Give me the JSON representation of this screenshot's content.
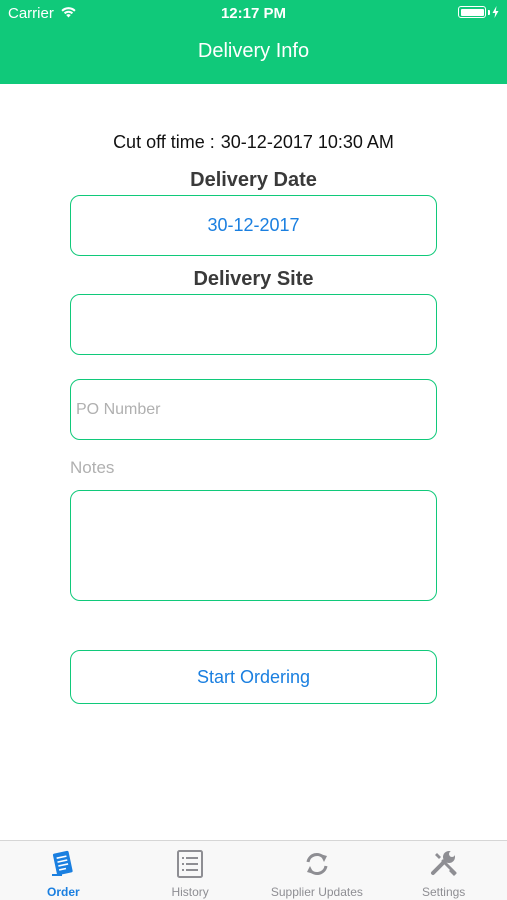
{
  "status_bar": {
    "carrier": "Carrier",
    "time": "12:17 PM"
  },
  "header": {
    "title": "Delivery Info"
  },
  "form": {
    "cutoff_label": "Cut off time :",
    "cutoff_value": "30-12-2017 10:30 AM",
    "delivery_date_label": "Delivery Date",
    "delivery_date_value": "30-12-2017",
    "delivery_site_label": "Delivery Site",
    "delivery_site_value": "",
    "po_number_placeholder": "PO Number",
    "notes_label": "Notes",
    "notes_value": "",
    "start_button_label": "Start Ordering"
  },
  "tabbar": {
    "tabs": [
      {
        "label": "Order",
        "icon": "order-icon",
        "active": true
      },
      {
        "label": "History",
        "icon": "history-icon",
        "active": false
      },
      {
        "label": "Supplier Updates",
        "icon": "refresh-icon",
        "active": false
      },
      {
        "label": "Settings",
        "icon": "wrench-screwdriver-icon",
        "active": false
      }
    ]
  },
  "colors": {
    "accent_green": "#10c97a",
    "link_blue": "#1a7fe0",
    "inactive_gray": "#8e8e93",
    "placeholder_gray": "#b0b0b0"
  }
}
